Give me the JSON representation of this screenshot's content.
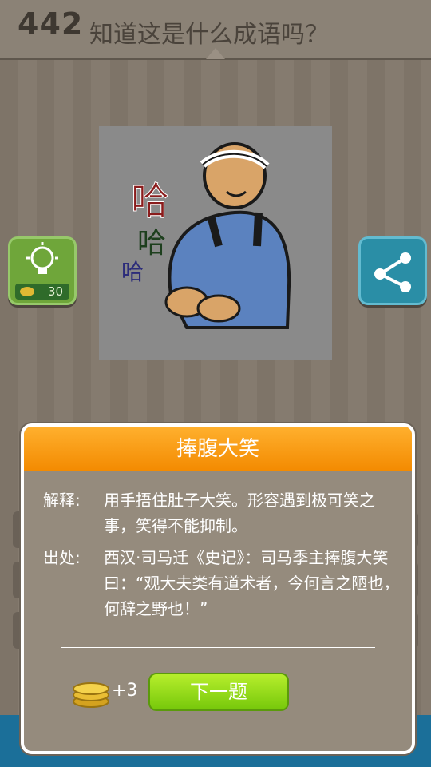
{
  "header": {
    "level": "442",
    "question": "知道这是什么成语吗？"
  },
  "puzzle": {
    "image": "laughing-man-illustration",
    "laugh_big": "哈",
    "laugh_mid": "哈",
    "laugh_small": "哈"
  },
  "hint_button": {
    "icon": "lightbulb-icon",
    "cost": "30"
  },
  "share_button": {
    "icon": "share-icon"
  },
  "dialog": {
    "title": "捧腹大笑",
    "explain_label": "解释:",
    "explain_text": "用手捂住肚子大笑。形容遇到极可笑之事，笑得不能抑制。",
    "source_label": "出处:",
    "source_text": "西汉·司马迁《史记》：司马季主捧腹大笑曰：“观大夫类有道术者，今何言之陋也，何辞之野也！”",
    "reward": "+3",
    "next_label": "下一题"
  },
  "colors": {
    "accent": "#f7950f",
    "next_button": "#8fd81a",
    "hint": "#6fa63a",
    "share": "#2a8ea6"
  }
}
